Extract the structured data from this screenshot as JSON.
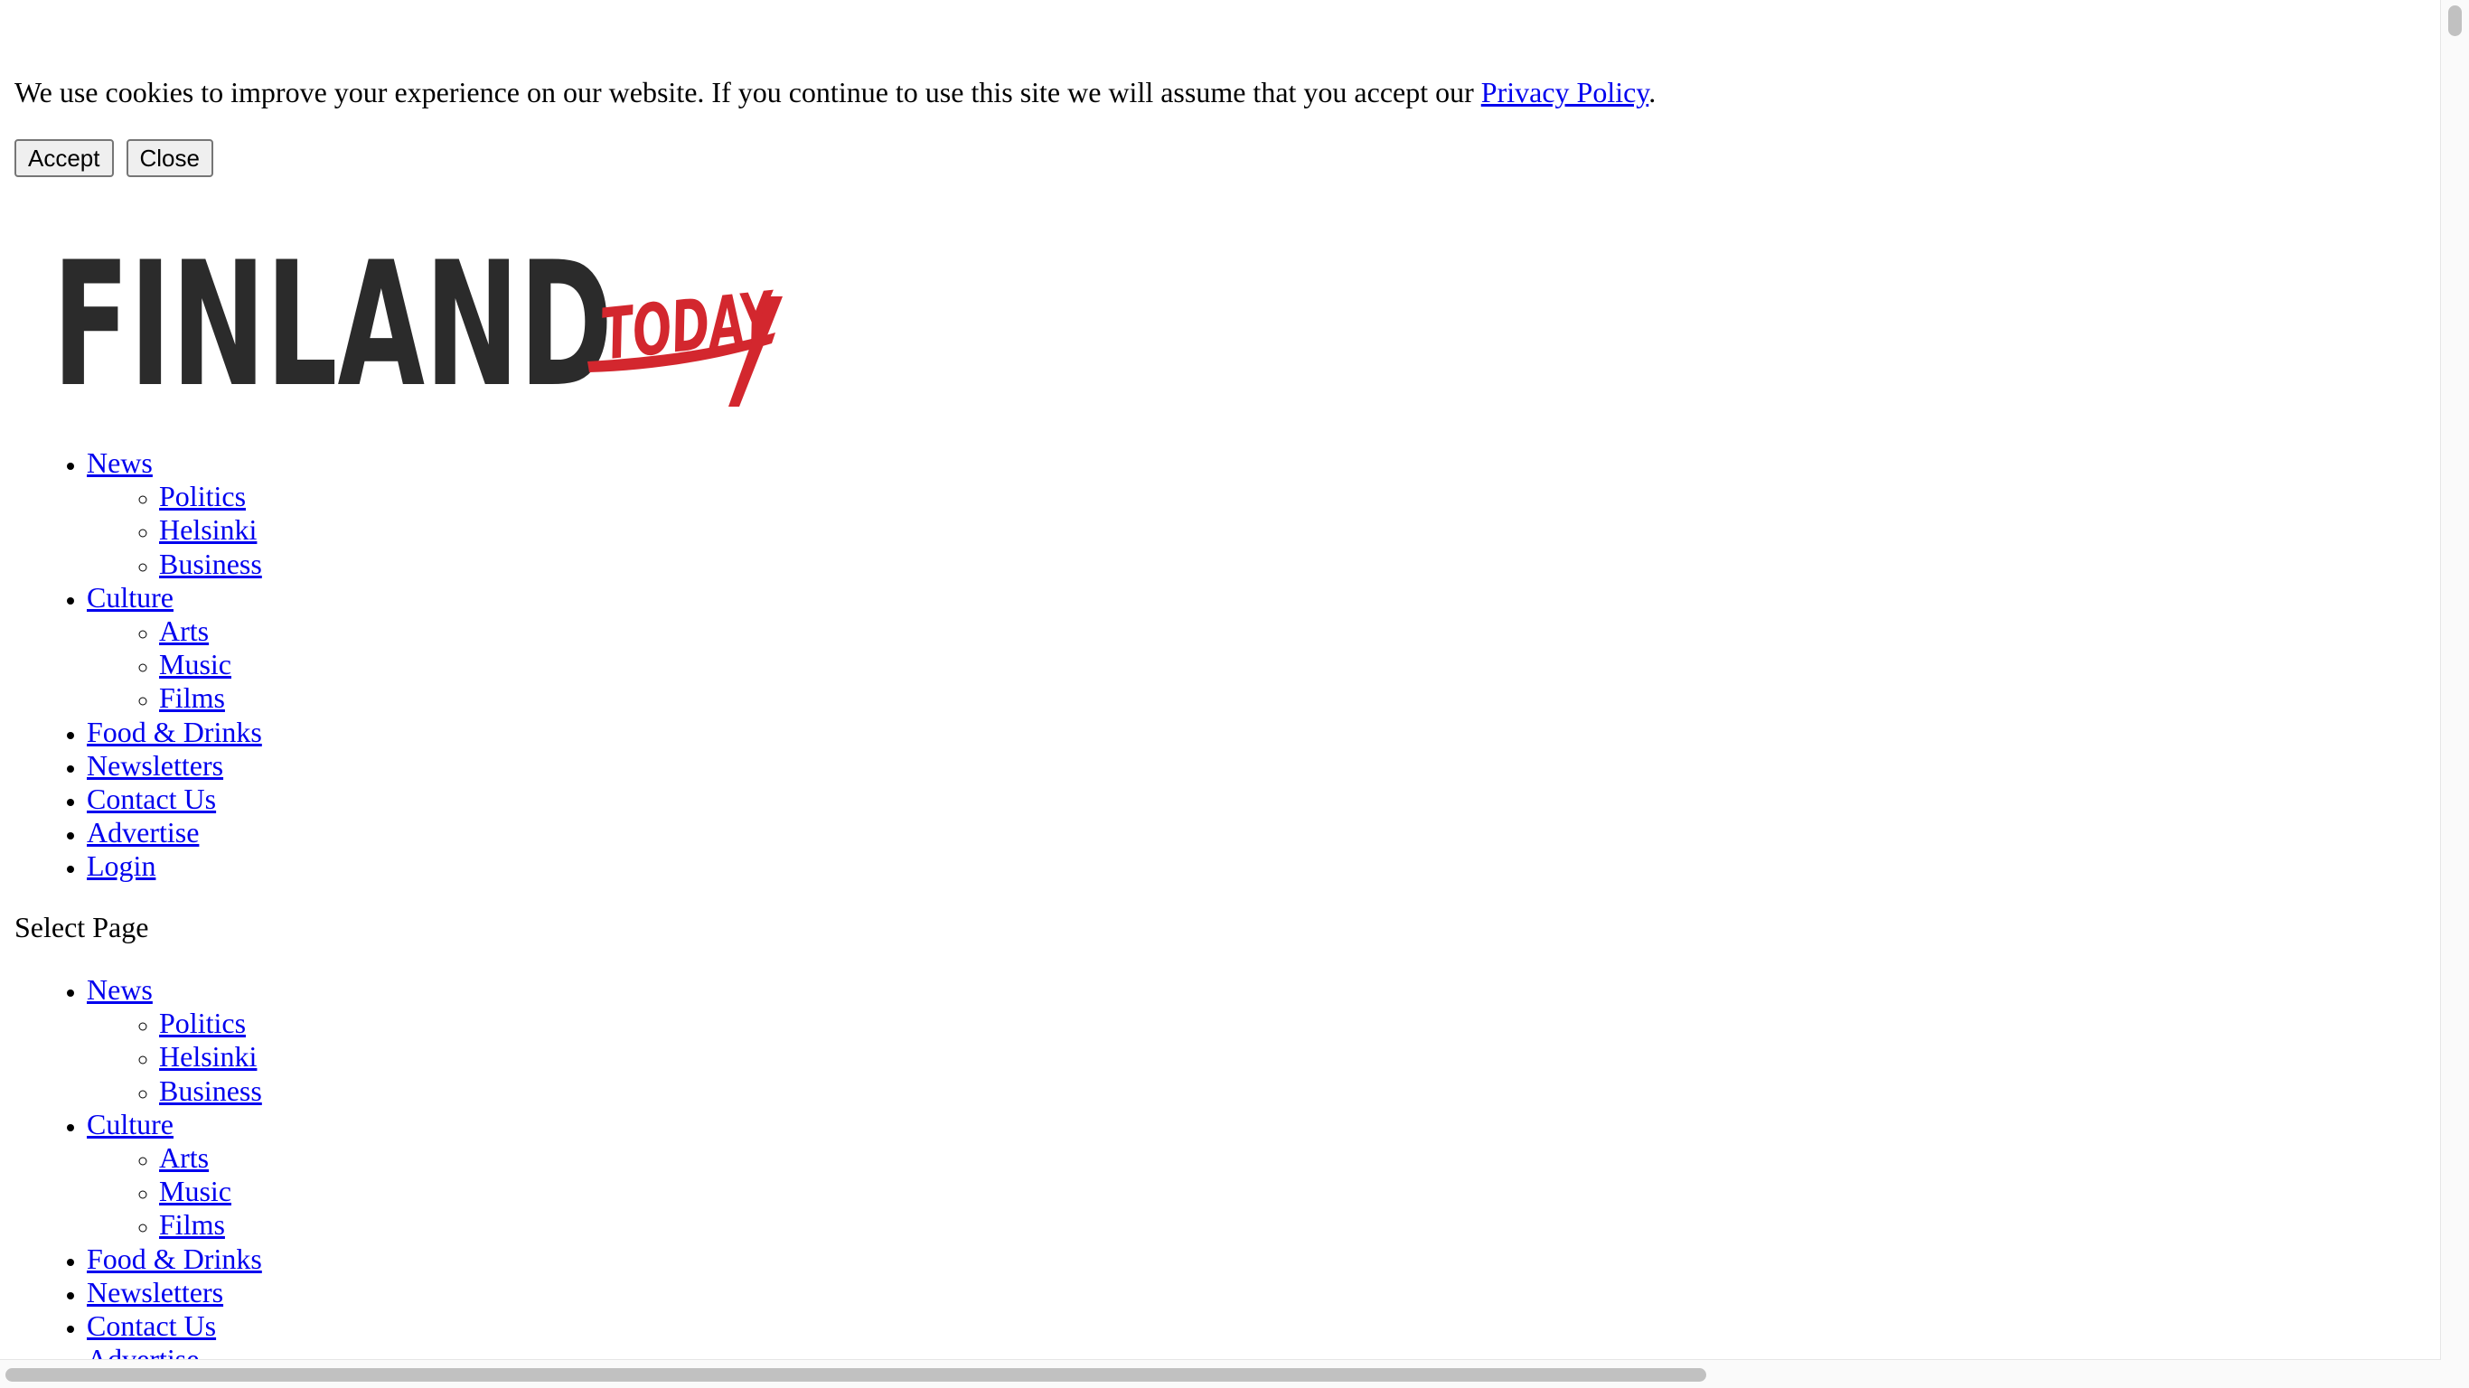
{
  "cookie_banner": {
    "message": "We use cookies to improve your experience on our website. If you continue to use this site we will assume that you accept our ",
    "policy_link": "Privacy Policy",
    "suffix": ".",
    "accept_label": "Accept",
    "close_label": "Close"
  },
  "logo": {
    "word_main": "FINLAND",
    "word_script": "TODAY",
    "colors": {
      "main": "#2b2b2b",
      "script": "#d3272e"
    }
  },
  "nav": {
    "items": [
      {
        "label": "News",
        "children": [
          "Politics",
          "Helsinki",
          "Business"
        ]
      },
      {
        "label": "Culture",
        "children": [
          "Arts",
          "Music",
          "Films"
        ]
      },
      {
        "label": "Food & Drinks"
      },
      {
        "label": "Newsletters"
      },
      {
        "label": "Contact Us"
      },
      {
        "label": "Advertise"
      },
      {
        "label": "Login"
      }
    ]
  },
  "select_page": "Select Page",
  "nav2": {
    "items": [
      {
        "label": "News",
        "children": [
          "Politics",
          "Helsinki",
          "Business"
        ]
      },
      {
        "label": "Culture",
        "children": [
          "Arts",
          "Music",
          "Films"
        ]
      },
      {
        "label": "Food & Drinks"
      },
      {
        "label": "Newsletters"
      },
      {
        "label": "Contact Us"
      },
      {
        "label": "Advertise"
      }
    ]
  },
  "colors": {
    "link": "#0000ee",
    "background": "#ffffff",
    "scrollbar_thumb": "#c1c1c1"
  }
}
